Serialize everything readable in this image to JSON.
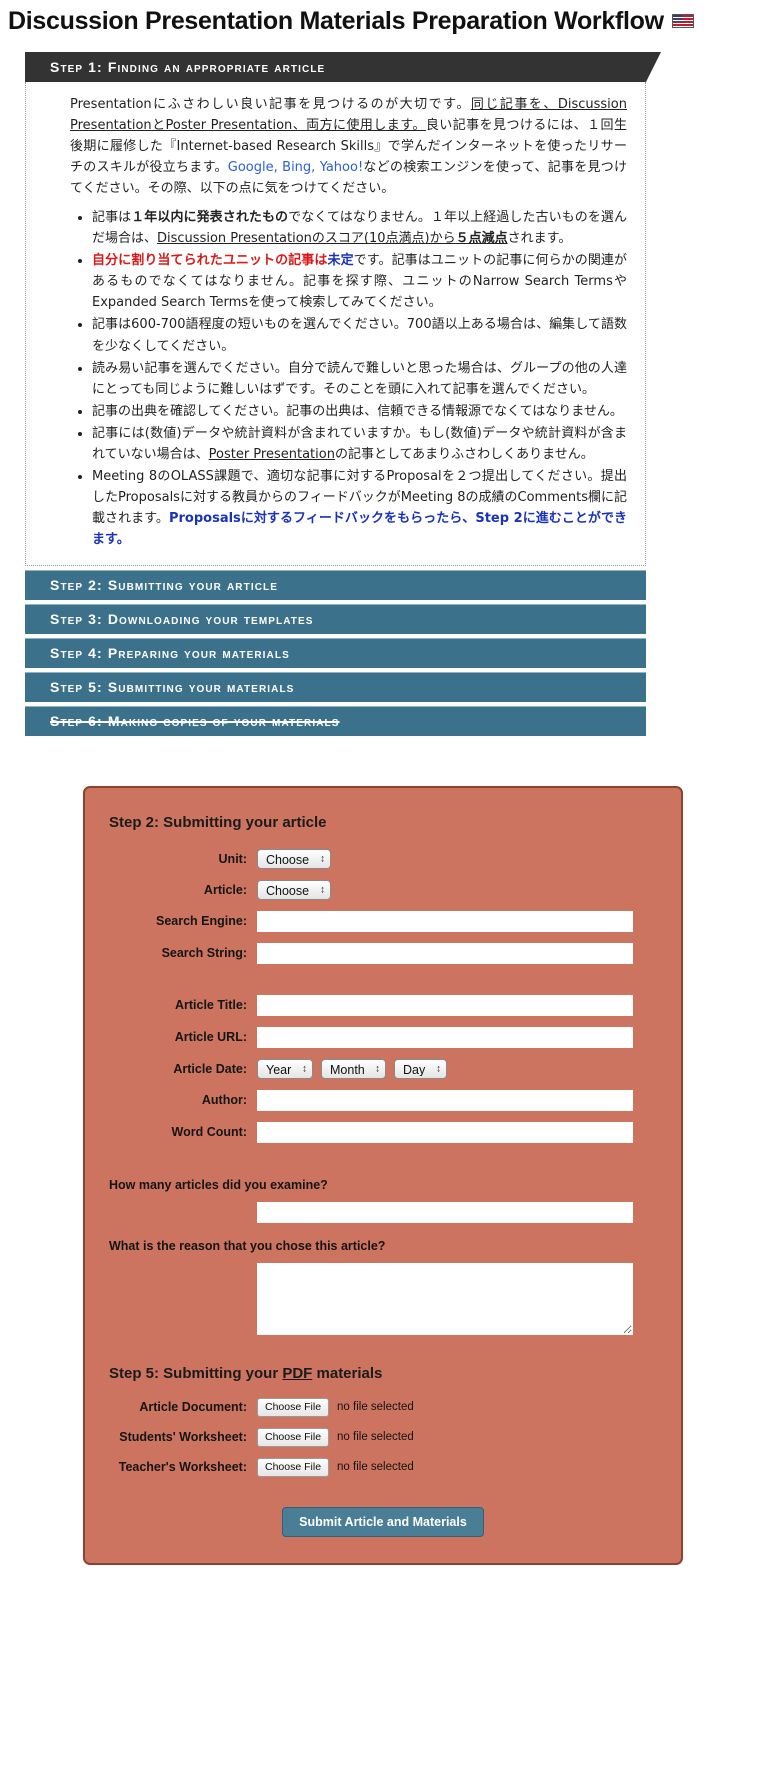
{
  "header": {
    "title": "Discussion Presentation Materials Preparation Workflow",
    "flag_icon": "us-uk-flag-icon"
  },
  "steps": [
    {
      "id": "step1",
      "label": "Step 1: Finding an appropriate article",
      "state": "expanded",
      "strikethrough": false
    },
    {
      "id": "step2",
      "label": "Step 2: Submitting your article",
      "state": "collapsed",
      "strikethrough": false
    },
    {
      "id": "step3",
      "label": "Step 3: Downloading your templates",
      "state": "collapsed",
      "strikethrough": false
    },
    {
      "id": "step4",
      "label": "Step 4: Preparing your materials",
      "state": "collapsed",
      "strikethrough": false
    },
    {
      "id": "step5",
      "label": "Step 5: Submitting your materials",
      "state": "collapsed",
      "strikethrough": false
    },
    {
      "id": "step6",
      "label": "Step 6: Making copies of your materials",
      "state": "collapsed",
      "strikethrough": true
    }
  ],
  "step1_body": {
    "intro_parts": [
      {
        "text": "Presentationにふさわしい良い記事を見つけるのが大切です。",
        "style": "plain"
      },
      {
        "text": "同じ記事を、Discussion PresentationとPoster Presentation、両方に使用します。",
        "style": "underline"
      },
      {
        "text": "良い記事を見つけるには、１回生後期に履修した『Internet-based Research Skills』で学んだインターネットを使ったリサーチのスキルが役立ちます。",
        "style": "plain"
      },
      {
        "text": "Google, Bing, Yahoo!",
        "style": "link"
      },
      {
        "text": "などの検索エンジンを使って、記事を見つけてください。その際、以下の点に気をつけてください。",
        "style": "plain"
      }
    ],
    "bullets": [
      {
        "segments": [
          {
            "text": "記事は",
            "style": "plain"
          },
          {
            "text": "１年以内に発表されたもの",
            "style": "bold"
          },
          {
            "text": "でなくてはなりません。１年以上経過した古いものを選んだ場合は、",
            "style": "plain"
          },
          {
            "text": "Discussion Presentationのスコア(10点満点)から",
            "style": "underline"
          },
          {
            "text": "５点減点",
            "style": "bold-underline"
          },
          {
            "text": "されます。",
            "style": "plain"
          }
        ]
      },
      {
        "segments": [
          {
            "text": "自分に割り当てられたユニットの記事は",
            "style": "red"
          },
          {
            "text": "未定",
            "style": "navy"
          },
          {
            "text": "です。記事はユニットの記事に何らかの関連があるものでなくてはなりません。記事を探す際、ユニットのNarrow Search TermsやExpanded Search Termsを使って検索してみてください。",
            "style": "plain"
          }
        ]
      },
      {
        "segments": [
          {
            "text": "記事は600-700語程度の短いものを選んでください。700語以上ある場合は、編集して語数を少なくしてください。",
            "style": "plain"
          }
        ]
      },
      {
        "segments": [
          {
            "text": "読み易い記事を選んでください。自分で読んで難しいと思った場合は、グループの他の人達にとっても同じように難しいはずです。そのことを頭に入れて記事を選んでください。",
            "style": "plain"
          }
        ]
      },
      {
        "segments": [
          {
            "text": "記事の出典を確認してください。記事の出典は、信頼できる情報源でなくてはなりません。",
            "style": "plain"
          }
        ]
      },
      {
        "segments": [
          {
            "text": "記事には(数値)データや統計資料が含まれていますか。もし(数値)データや統計資料が含まれていない場合は、",
            "style": "plain"
          },
          {
            "text": "Poster Presentation",
            "style": "underline"
          },
          {
            "text": "の記事としてあまりふさわしくありません。",
            "style": "plain"
          }
        ]
      },
      {
        "segments": [
          {
            "text": "Meeting 8のOLASS課題で、適切な記事に対するProposalを２つ提出してください。提出したProposalsに対する教員からのフィードバックがMeeting 8の成績のComments欄に記載されます。",
            "style": "plain"
          },
          {
            "text": "Proposalsに対するフィードバックをもらったら、Step 2に進むことができます。",
            "style": "navy"
          }
        ]
      }
    ]
  },
  "form": {
    "heading": "Step 2: Submitting your article",
    "accent_color": "#cc7460",
    "border_color": "#8e4230",
    "fields": [
      {
        "name": "unit",
        "label": "Unit:",
        "type": "select",
        "value": "Choose"
      },
      {
        "name": "article",
        "label": "Article:",
        "type": "select",
        "value": "Choose"
      },
      {
        "name": "search-engine",
        "label": "Search Engine:",
        "type": "text",
        "value": ""
      },
      {
        "name": "search-string",
        "label": "Search String:",
        "type": "text",
        "value": ""
      },
      {
        "name": "article-title",
        "label": "Article Title:",
        "type": "text",
        "value": ""
      },
      {
        "name": "article-url",
        "label": "Article URL:",
        "type": "text",
        "value": ""
      },
      {
        "name": "author",
        "label": "Author:",
        "type": "text",
        "value": ""
      },
      {
        "name": "word-count",
        "label": "Word Count:",
        "type": "text",
        "value": ""
      }
    ],
    "date_row": {
      "label": "Article Date:",
      "year": "Year",
      "month": "Month",
      "day": "Day"
    },
    "question1": {
      "label": "How many articles did you examine?",
      "value": ""
    },
    "question2": {
      "label": "What is the reason that you chose this article?",
      "value": ""
    },
    "section5": {
      "heading_before": "Step 5: Submitting your ",
      "heading_underlined": "PDF",
      "heading_after": " materials",
      "uploads": [
        {
          "name": "article-document",
          "label": "Article Document:",
          "button": "Choose File",
          "status": "no file selected"
        },
        {
          "name": "students-worksheet",
          "label": "Students' Worksheet:",
          "button": "Choose File",
          "status": "no file selected"
        },
        {
          "name": "teachers-worksheet",
          "label": "Teacher's Worksheet:",
          "button": "Choose File",
          "status": "no file selected"
        }
      ]
    },
    "submit_label": "Submit Article and Materials"
  }
}
